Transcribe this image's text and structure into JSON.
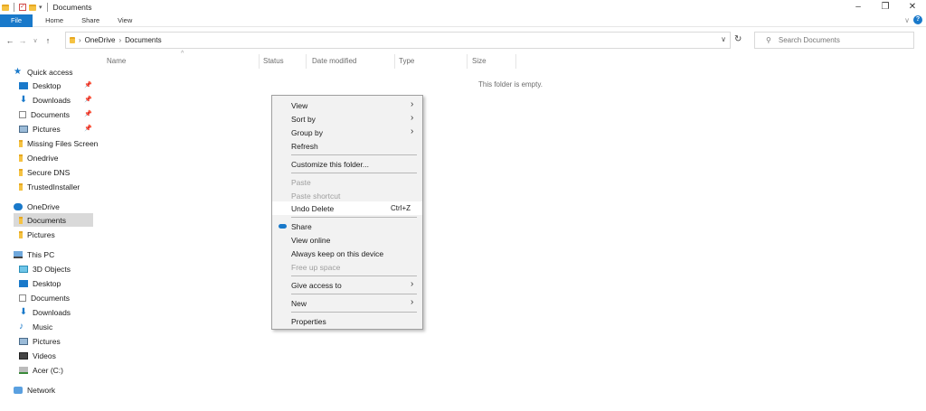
{
  "window": {
    "title": "Documents",
    "controls": {
      "minimize": "–",
      "maximize": "❐",
      "close": "✕"
    }
  },
  "ribbon": {
    "tabs": [
      "File",
      "Home",
      "Share",
      "View"
    ],
    "help": "?"
  },
  "address": {
    "crumbs": [
      "OneDrive",
      "Documents"
    ],
    "search_placeholder": "Search Documents"
  },
  "nav_pane": {
    "quick_access": {
      "label": "Quick access",
      "items": [
        "Desktop",
        "Downloads",
        "Documents",
        "Pictures",
        "Missing Files Screen",
        "Onedrive",
        "Secure DNS",
        "TrustedInstaller"
      ]
    },
    "onedrive": {
      "label": "OneDrive",
      "items": [
        "Documents",
        "Pictures"
      ]
    },
    "this_pc": {
      "label": "This PC",
      "items": [
        "3D Objects",
        "Desktop",
        "Documents",
        "Downloads",
        "Music",
        "Pictures",
        "Videos",
        "Acer (C:)"
      ]
    },
    "network": {
      "label": "Network"
    }
  },
  "columns": [
    "Name",
    "Status",
    "Date modified",
    "Type",
    "Size"
  ],
  "empty_text": "This folder is empty.",
  "context_menu": {
    "view": "View",
    "sort_by": "Sort by",
    "group_by": "Group by",
    "refresh": "Refresh",
    "customize": "Customize this folder...",
    "paste": "Paste",
    "paste_shortcut": "Paste shortcut",
    "undo_delete": "Undo Delete",
    "undo_shortcut": "Ctrl+Z",
    "share": "Share",
    "view_online": "View online",
    "always_keep": "Always keep on this device",
    "free_up": "Free up space",
    "give_access": "Give access to",
    "new": "New",
    "properties": "Properties"
  }
}
